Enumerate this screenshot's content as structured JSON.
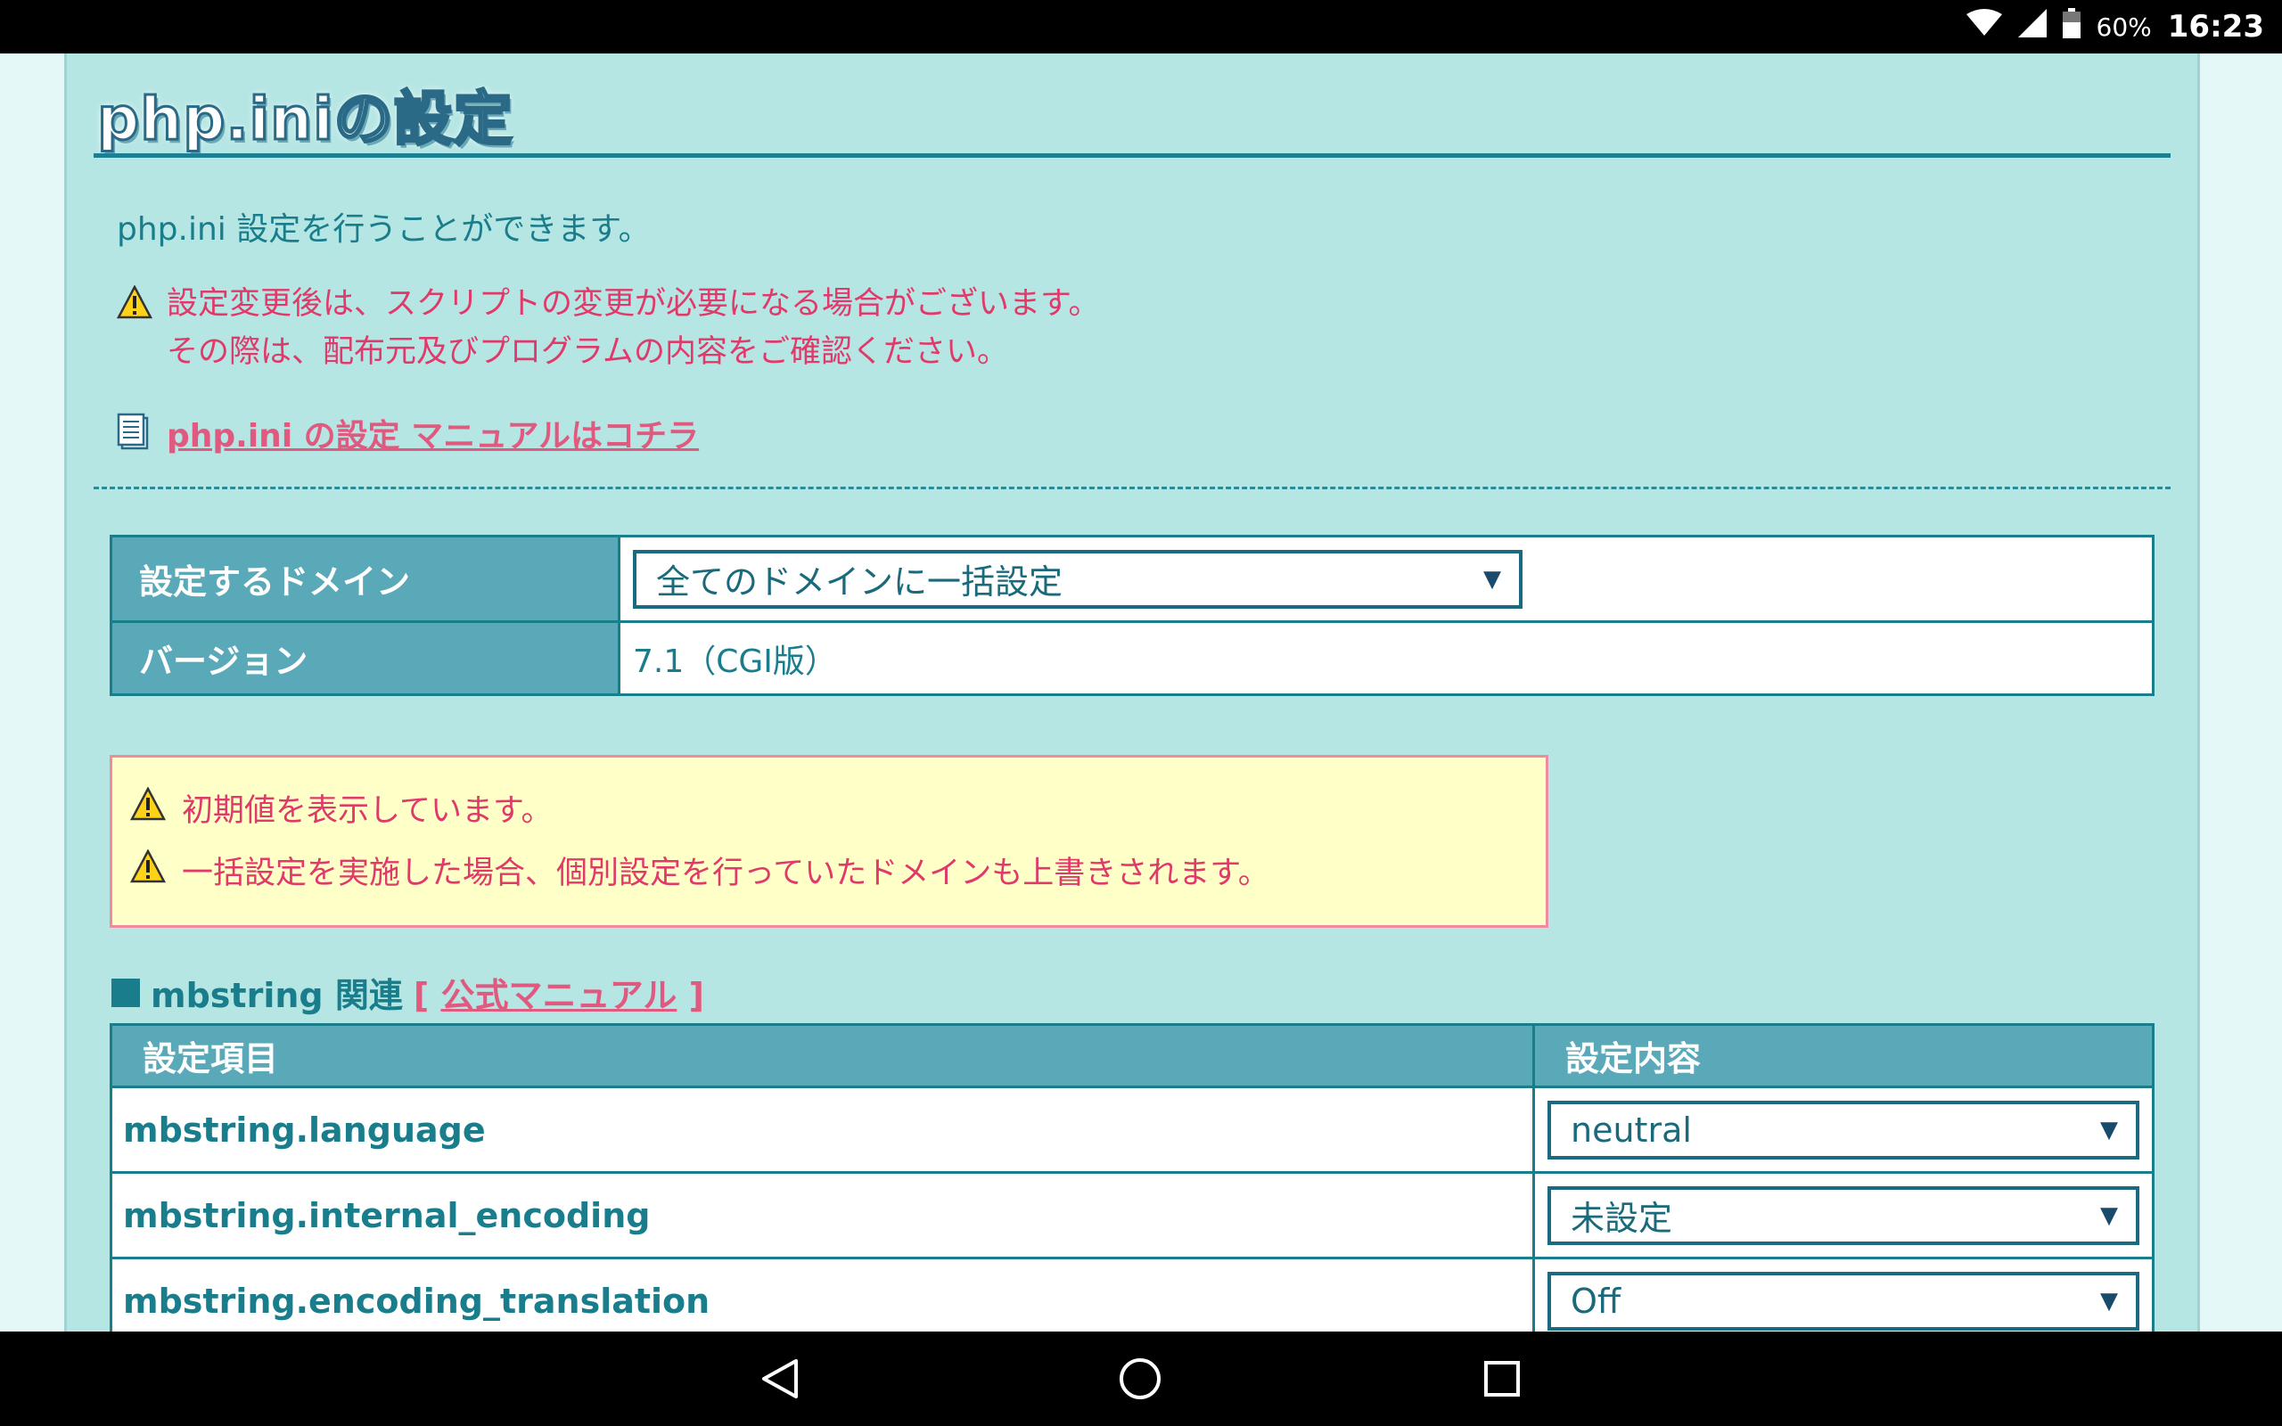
{
  "status_bar": {
    "battery_percent": "60%",
    "time": "16:23"
  },
  "page": {
    "title": "php.iniの設定",
    "intro": "php.ini 設定を行うことができます。",
    "warning_lines": [
      "設定変更後は、スクリプトの変更が必要になる場合がございます。",
      "その際は、配布元及びプログラムの内容をご確認ください。"
    ],
    "manual_link": "php.ini の設定 マニュアルはコチラ"
  },
  "domain_table": {
    "domain_label": "設定するドメイン",
    "domain_value": "全てのドメインに一括設定",
    "version_label": "バージョン",
    "version_value": "7.1（CGI版）"
  },
  "notice": {
    "lines": [
      "初期値を表示しています。",
      "一括設定を実施した場合、個別設定を行っていたドメインも上書きされます。"
    ]
  },
  "section": {
    "title": "mbstring 関連",
    "manual_link": "公式マニュアル",
    "open_bracket": "[",
    "close_bracket": "]"
  },
  "settings_table": {
    "col_item": "設定項目",
    "col_value": "設定内容",
    "rows": [
      {
        "name": "mbstring.language",
        "value": "neutral"
      },
      {
        "name": "mbstring.internal_encoding",
        "value": "未設定"
      },
      {
        "name": "mbstring.encoding_translation",
        "value": "Off"
      }
    ]
  },
  "icons": {
    "warning": "warning-triangle-icon",
    "document": "document-icon",
    "back": "back-icon",
    "home": "home-icon",
    "recents": "recents-icon"
  },
  "colors": {
    "teal": "#1a7d8c",
    "pink": "#e03a6a",
    "header_bg": "#5aa9b9",
    "content_bg": "#b6e6e4"
  }
}
